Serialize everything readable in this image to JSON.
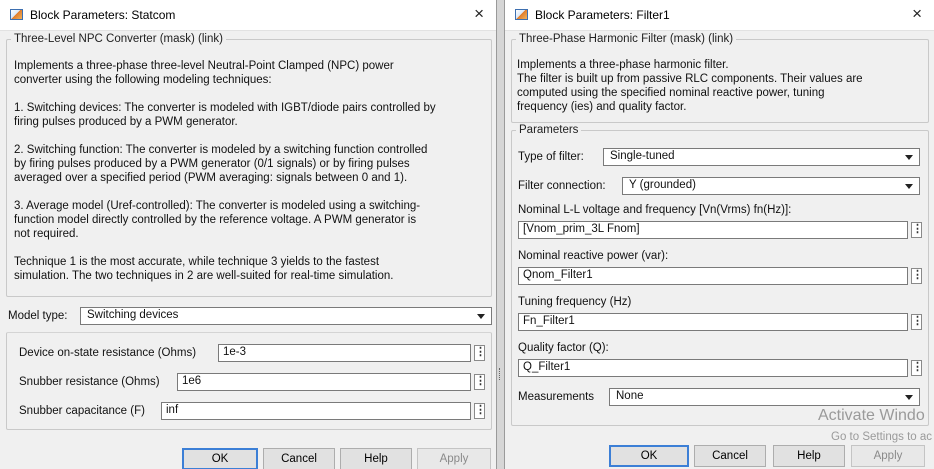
{
  "left": {
    "window_title": "Block Parameters: Statcom",
    "close_glyph": "×",
    "group_title": "Three-Level NPC Converter (mask) (link)",
    "description_lines": [
      "Implements a three-phase three-level Neutral-Point Clamped (NPC) power",
      "converter using the following modeling techniques:",
      "",
      "1. Switching devices: The converter is modeled with IGBT/diode pairs controlled by",
      "firing pulses produced by a PWM generator.",
      "",
      "2. Switching function: The converter is modeled by a switching function controlled",
      "by firing pulses produced by a PWM generator (0/1 signals) or by firing pulses",
      "averaged over a specified period (PWM averaging: signals between 0 and 1).",
      "",
      "3. Average model (Uref-controlled): The converter is modeled using a switching-",
      "function model directly controlled by the reference voltage. A PWM generator is",
      "not required.",
      "",
      "Technique 1 is the most accurate, while technique 3 yields to the fastest",
      "simulation. The two techniques in 2 are well-suited for real-time simulation."
    ],
    "model_type_label": "Model type:",
    "model_type_value": "Switching devices",
    "params": [
      {
        "label": "Device on-state resistance (Ohms)",
        "value": "1e-3"
      },
      {
        "label": "Snubber resistance (Ohms)",
        "value": "1e6"
      },
      {
        "label": "Snubber capacitance (F)",
        "value": "inf"
      }
    ],
    "buttons": {
      "ok": "OK",
      "cancel": "Cancel",
      "help": "Help",
      "apply": "Apply"
    }
  },
  "right": {
    "window_title": "Block Parameters: Filter1",
    "close_glyph": "×",
    "group_title": "Three-Phase Harmonic Filter (mask) (link)",
    "description_lines": [
      "Implements a three-phase harmonic filter.",
      "The filter is built up from passive RLC components. Their values are",
      "computed using the specified  nominal reactive power, tuning",
      "frequency (ies) and quality factor."
    ],
    "parameters_title": "Parameters",
    "type_of_filter_label": "Type of filter:",
    "type_of_filter_value": "Single-tuned",
    "filter_connection_label": "Filter connection:",
    "filter_connection_value": "Y (grounded)",
    "nominal_voltage_label": "Nominal L-L voltage and frequency  [Vn(Vrms) fn(Hz)]:",
    "nominal_voltage_value": "[Vnom_prim_3L Fnom]",
    "reactive_power_label": "Nominal reactive power (var):",
    "reactive_power_value": "Qnom_Filter1",
    "tuning_frequency_label": "Tuning frequency (Hz)",
    "tuning_frequency_value": "Fn_Filter1",
    "quality_factor_label": "Quality factor (Q):",
    "quality_factor_value": "Q_Filter1",
    "measurements_label": "Measurements",
    "measurements_value": "None",
    "buttons": {
      "ok": "OK",
      "cancel": "Cancel",
      "help": "Help",
      "apply": "Apply"
    }
  },
  "field_menu_glyph": "⋮",
  "watermark": {
    "line1": "Activate Windo",
    "line2": "Go to Settings to ac"
  }
}
